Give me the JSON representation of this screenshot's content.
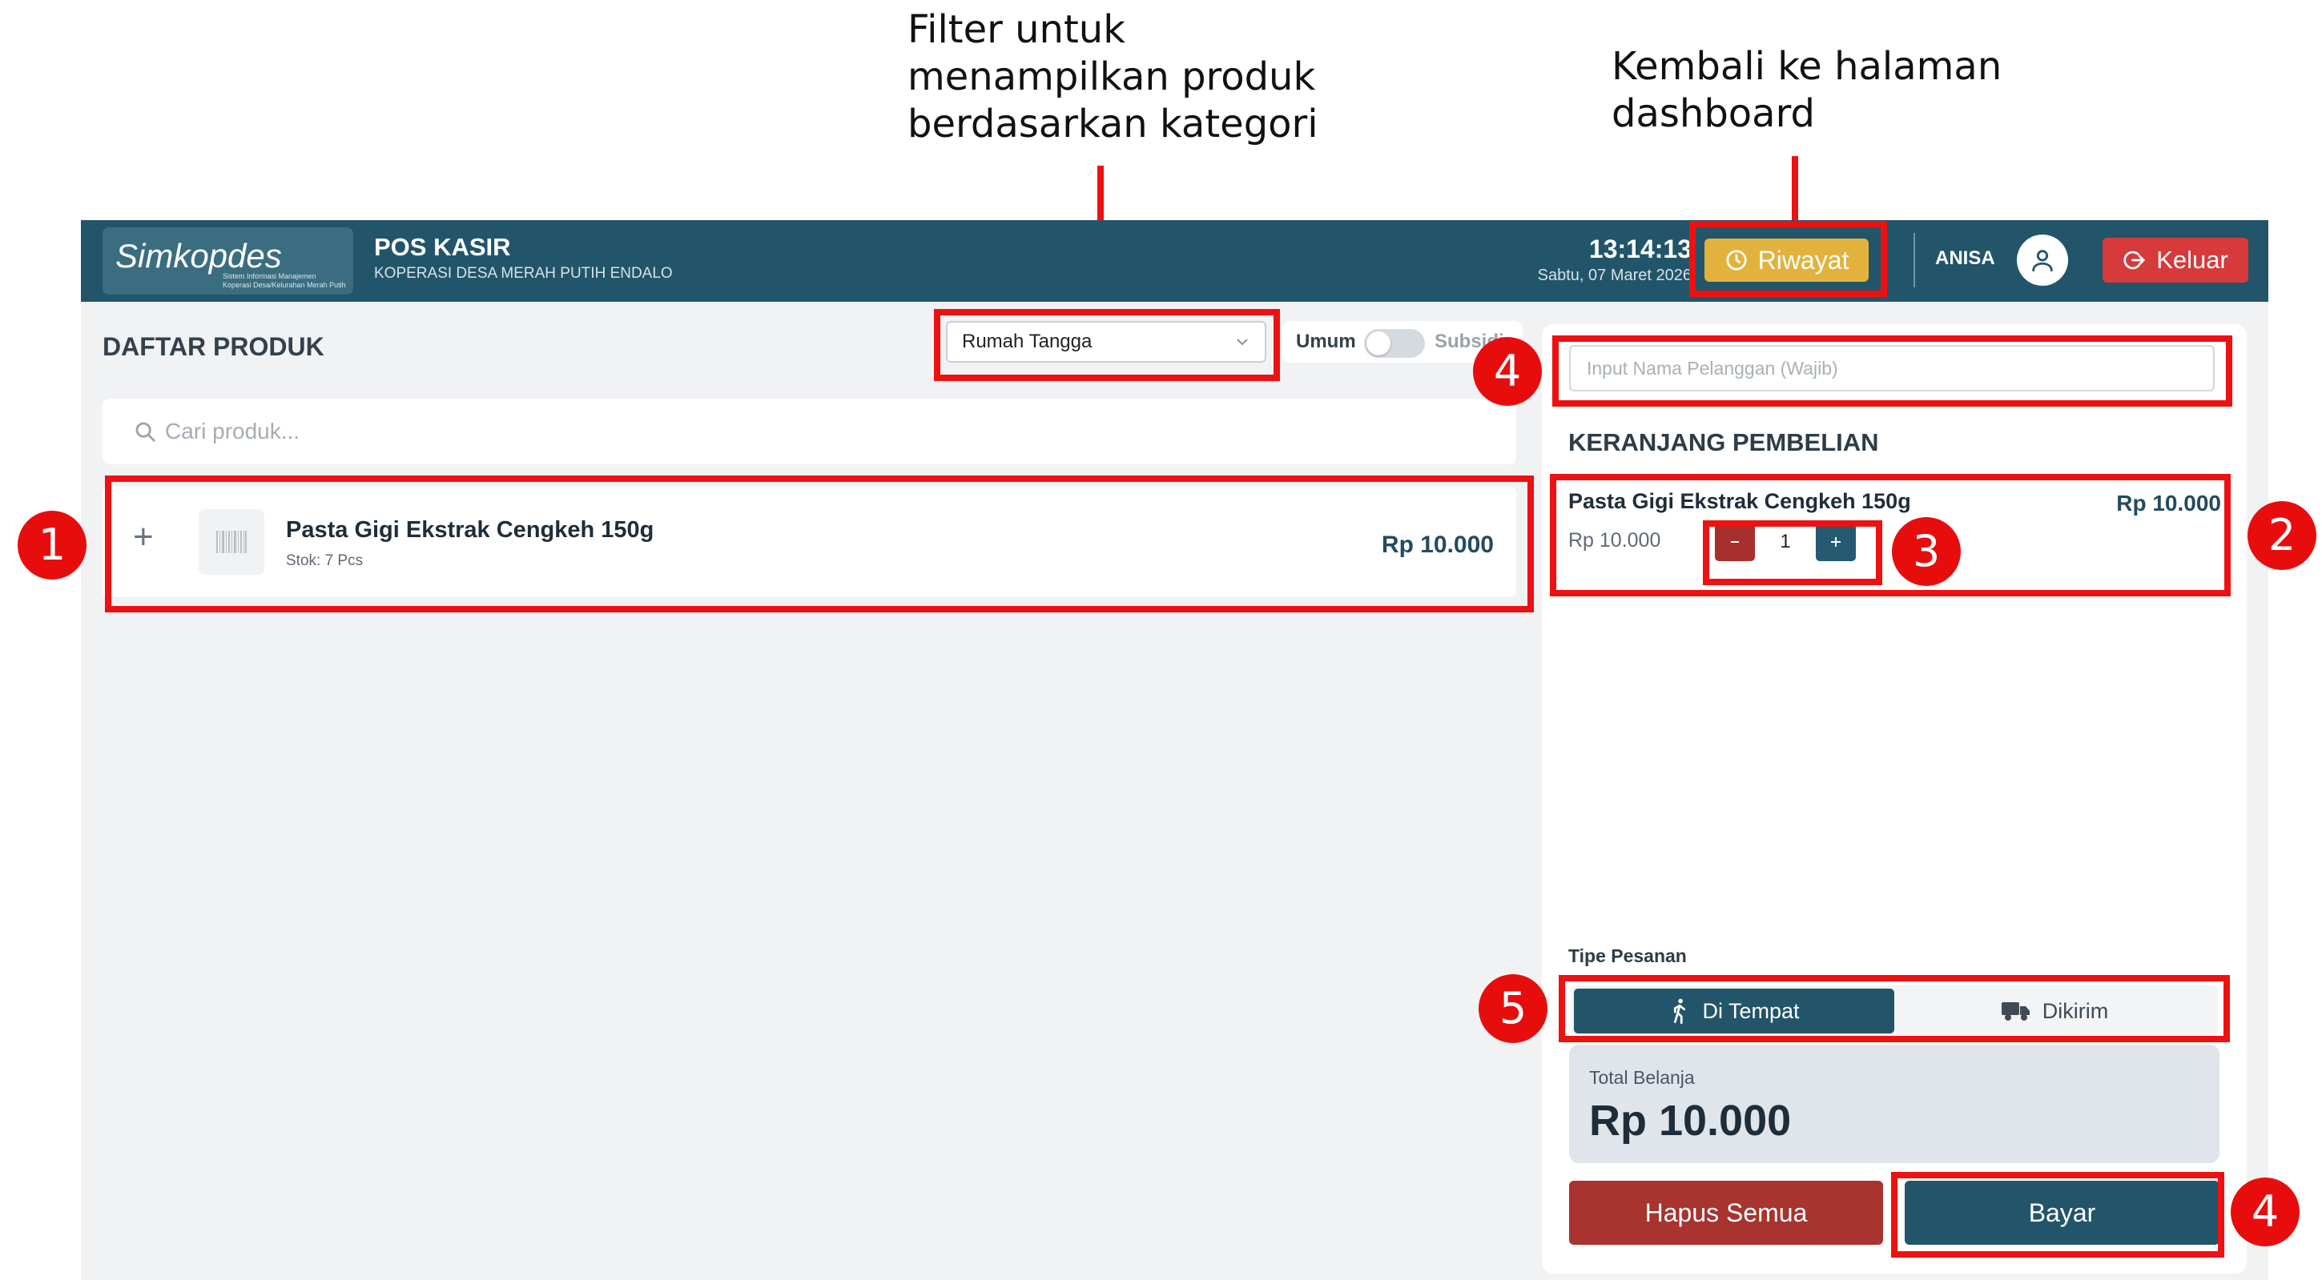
{
  "annotations": {
    "filter_caption": [
      "Filter untuk",
      "menampilkan produk",
      "berdasarkan kategori"
    ],
    "dashboard_caption": [
      "Kembali ke halaman",
      "dashboard"
    ],
    "badges": [
      "1",
      "2",
      "3",
      "4",
      "4",
      "5"
    ],
    "highlight_color": "#ee1111"
  },
  "header": {
    "logo_text": "Simkopdes",
    "logo_sub1": "Sistem Informasi Manajemen",
    "logo_sub2": "Koperasi Desa/Kelurahan Merah Putih",
    "title": "POS KASIR",
    "subtitle": "KOPERASI DESA MERAH PUTIH ENDALO",
    "time": "13:14:13",
    "date": "Sabtu, 07 Maret 2026",
    "riwayat_label": "Riwayat",
    "user_name": "ANISA",
    "keluar_label": "Keluar",
    "bar_color": "#22556a"
  },
  "products_panel": {
    "title": "DAFTAR PRODUK",
    "category_selected": "Rumah Tangga",
    "toggle_left": "Umum",
    "toggle_right": "Subsidi",
    "search_placeholder": "Cari produk...",
    "items": [
      {
        "name": "Pasta Gigi Ekstrak Cengkeh 150g",
        "stock": "Stok: 7 Pcs",
        "price": "Rp 10.000"
      }
    ]
  },
  "cart": {
    "customer_placeholder": "Input Nama Pelanggan (Wajib)",
    "title": "KERANJANG PEMBELIAN",
    "items": [
      {
        "name": "Pasta Gigi Ekstrak Cengkeh 150g",
        "unit_price": "Rp 10.000",
        "qty": "1",
        "total": "Rp 10.000"
      }
    ],
    "order_type_label": "Tipe Pesanan",
    "order_types": [
      "Di Tempat",
      "Dikirim"
    ],
    "total_label": "Total Belanja",
    "total_value": "Rp 10.000",
    "clear_label": "Hapus Semua",
    "pay_label": "Bayar"
  }
}
